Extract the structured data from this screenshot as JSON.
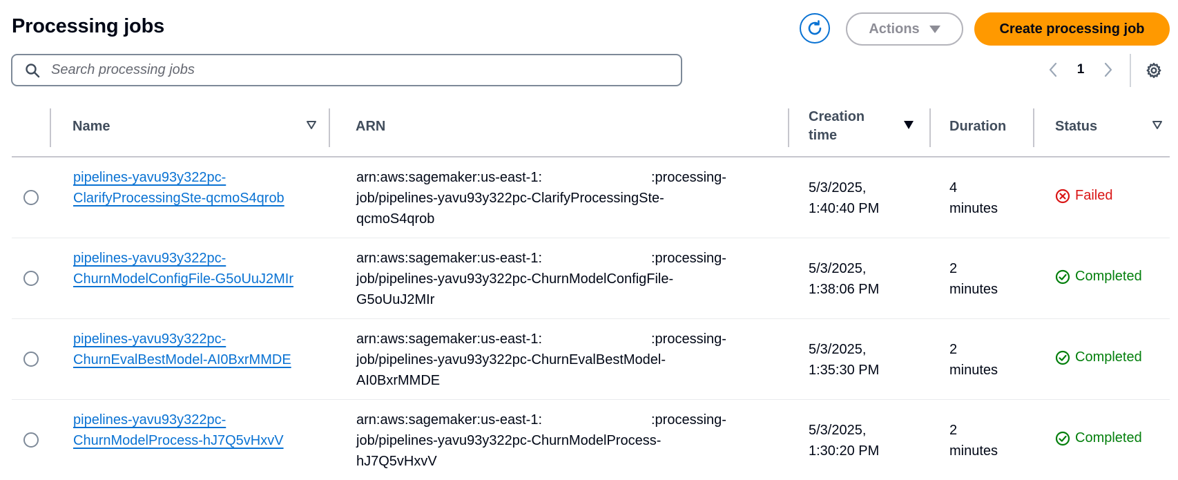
{
  "page": {
    "title": "Processing jobs",
    "actions_label": "Actions",
    "create_label": "Create processing job"
  },
  "search": {
    "placeholder": "Search processing jobs",
    "value": ""
  },
  "pagination": {
    "current_page": "1"
  },
  "columns": {
    "name": "Name",
    "arn": "ARN",
    "creation_time_line1": "Creation",
    "creation_time_line2": "time",
    "duration": "Duration",
    "status": "Status"
  },
  "rows": [
    {
      "name_line1": "pipelines-yavu93y322pc-",
      "name_line2": "ClarifyProcessingSte-qcmoS4qrob",
      "arn_line1a": "arn:aws:sagemaker:us-east-1:",
      "arn_line1b": ":processing-",
      "arn_line2": "job/pipelines-yavu93y322pc-ClarifyProcessingSte-",
      "arn_line3": "qcmoS4qrob",
      "creation_date": "5/3/2025,",
      "creation_time": "1:40:40 PM",
      "duration_num": "4",
      "duration_unit": "minutes",
      "status": "Failed",
      "status_type": "failed"
    },
    {
      "name_line1": "pipelines-yavu93y322pc-",
      "name_line2": "ChurnModelConfigFile-G5oUuJ2MIr",
      "arn_line1a": "arn:aws:sagemaker:us-east-1:",
      "arn_line1b": ":processing-",
      "arn_line2": "job/pipelines-yavu93y322pc-ChurnModelConfigFile-",
      "arn_line3": "G5oUuJ2MIr",
      "creation_date": "5/3/2025,",
      "creation_time": "1:38:06 PM",
      "duration_num": "2",
      "duration_unit": "minutes",
      "status": "Completed",
      "status_type": "completed"
    },
    {
      "name_line1": "pipelines-yavu93y322pc-",
      "name_line2": "ChurnEvalBestModel-AI0BxrMMDE",
      "arn_line1a": "arn:aws:sagemaker:us-east-1:",
      "arn_line1b": ":processing-",
      "arn_line2": "job/pipelines-yavu93y322pc-ChurnEvalBestModel-",
      "arn_line3": "AI0BxrMMDE",
      "creation_date": "5/3/2025,",
      "creation_time": "1:35:30 PM",
      "duration_num": "2",
      "duration_unit": "minutes",
      "status": "Completed",
      "status_type": "completed"
    },
    {
      "name_line1": "pipelines-yavu93y322pc-",
      "name_line2": "ChurnModelProcess-hJ7Q5vHxvV",
      "arn_line1a": "arn:aws:sagemaker:us-east-1:",
      "arn_line1b": ":processing-",
      "arn_line2": "job/pipelines-yavu93y322pc-ChurnModelProcess-",
      "arn_line3": "hJ7Q5vHxvV",
      "creation_date": "5/3/2025,",
      "creation_time": "1:30:20 PM",
      "duration_num": "2",
      "duration_unit": "minutes",
      "status": "Completed",
      "status_type": "completed"
    }
  ],
  "colors": {
    "link": "#0972d3",
    "primary_button": "#ff9900",
    "failed": "#d91515",
    "completed": "#037f0c"
  },
  "icons": {
    "refresh": "refresh-icon",
    "search": "search-icon",
    "settings": "gear-icon",
    "failed": "error-circle-icon",
    "completed": "check-circle-icon"
  }
}
